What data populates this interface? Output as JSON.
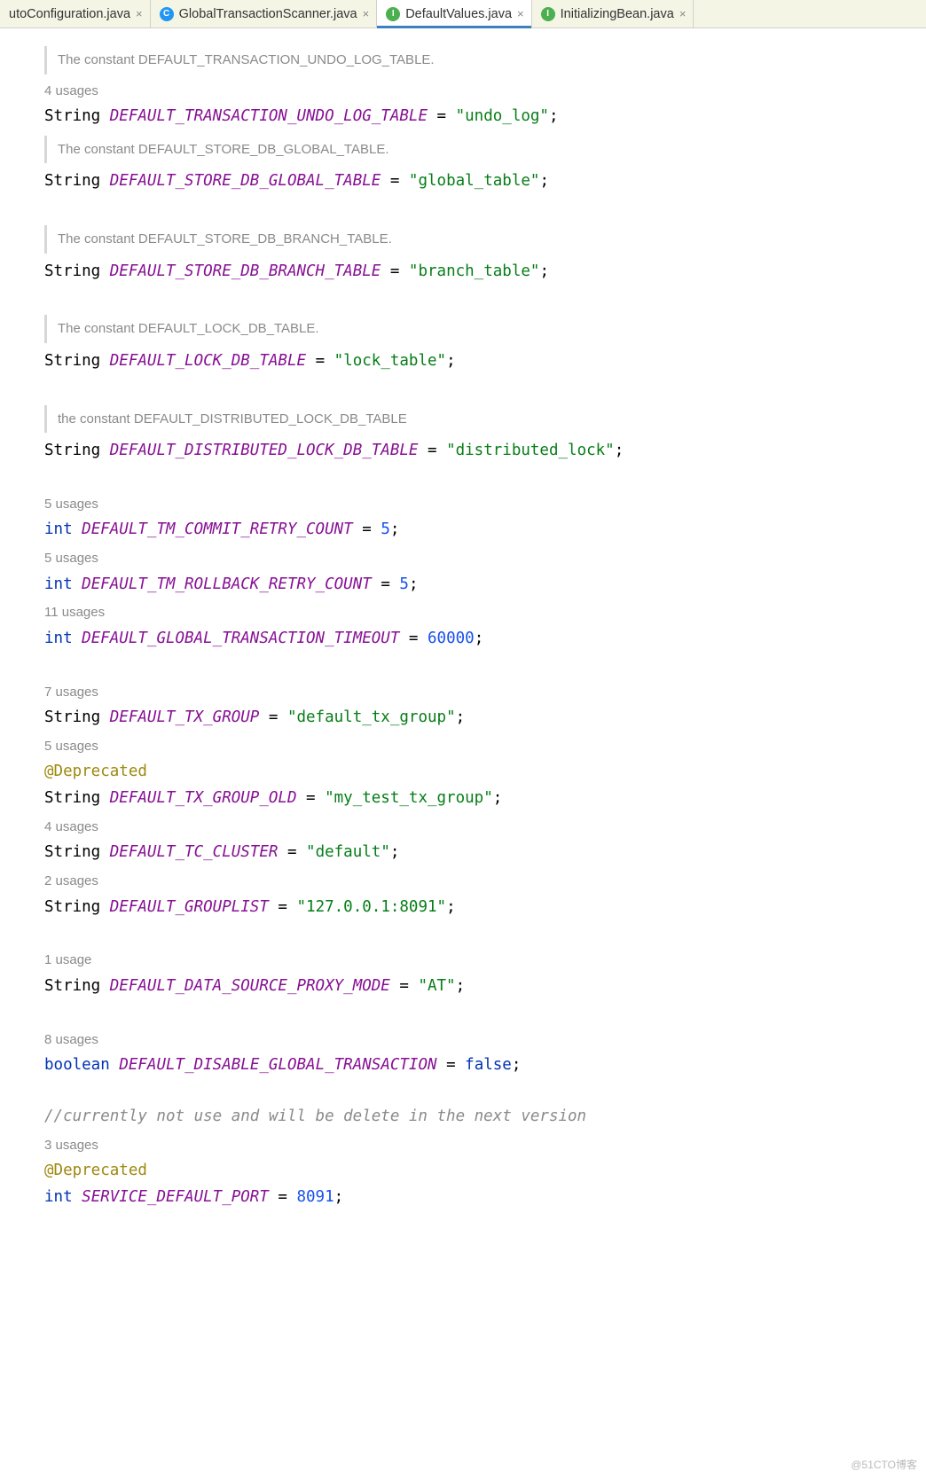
{
  "tabs": [
    {
      "label": "utoConfiguration.java",
      "icon": "",
      "active": false
    },
    {
      "label": "GlobalTransactionScanner.java",
      "icon": "C",
      "iconClass": "icon-c",
      "active": false
    },
    {
      "label": "DefaultValues.java",
      "icon": "I",
      "iconClass": "icon-i",
      "active": true
    },
    {
      "label": "InitializingBean.java",
      "icon": "I",
      "iconClass": "icon-i",
      "active": false
    }
  ],
  "close_glyph": "×",
  "watermark": "@51CTO博客",
  "blocks": [
    {
      "kind": "doc",
      "text": "The constant DEFAULT_TRANSACTION_UNDO_LOG_TABLE."
    },
    {
      "kind": "usages",
      "text": "4 usages"
    },
    {
      "kind": "decl",
      "type": "String",
      "name": "DEFAULT_TRANSACTION_UNDO_LOG_TABLE",
      "valKind": "str",
      "val": "\"undo_log\""
    },
    {
      "kind": "doc",
      "text": "The constant DEFAULT_STORE_DB_GLOBAL_TABLE."
    },
    {
      "kind": "decl",
      "type": "String",
      "name": "DEFAULT_STORE_DB_GLOBAL_TABLE",
      "valKind": "str",
      "val": "\"global_table\""
    },
    {
      "kind": "blank2"
    },
    {
      "kind": "doc",
      "text": "The constant DEFAULT_STORE_DB_BRANCH_TABLE."
    },
    {
      "kind": "decl",
      "type": "String",
      "name": "DEFAULT_STORE_DB_BRANCH_TABLE",
      "valKind": "str",
      "val": "\"branch_table\""
    },
    {
      "kind": "blank2"
    },
    {
      "kind": "doc",
      "text": "The constant DEFAULT_LOCK_DB_TABLE."
    },
    {
      "kind": "decl",
      "type": "String",
      "name": "DEFAULT_LOCK_DB_TABLE",
      "valKind": "str",
      "val": "\"lock_table\""
    },
    {
      "kind": "blank2"
    },
    {
      "kind": "doc",
      "text": "the constant DEFAULT_DISTRIBUTED_LOCK_DB_TABLE"
    },
    {
      "kind": "decl",
      "type": "String",
      "name": "DEFAULT_DISTRIBUTED_LOCK_DB_TABLE",
      "valKind": "str",
      "val": "\"distributed_lock\""
    },
    {
      "kind": "blank2"
    },
    {
      "kind": "usages",
      "text": "5 usages"
    },
    {
      "kind": "decl",
      "type": "int",
      "typeKw": true,
      "name": "DEFAULT_TM_COMMIT_RETRY_COUNT",
      "valKind": "num",
      "val": "5"
    },
    {
      "kind": "usages",
      "text": "5 usages"
    },
    {
      "kind": "decl",
      "type": "int",
      "typeKw": true,
      "name": "DEFAULT_TM_ROLLBACK_RETRY_COUNT",
      "valKind": "num",
      "val": "5"
    },
    {
      "kind": "usages",
      "text": "11 usages"
    },
    {
      "kind": "decl",
      "type": "int",
      "typeKw": true,
      "name": "DEFAULT_GLOBAL_TRANSACTION_TIMEOUT",
      "valKind": "num",
      "val": "60000"
    },
    {
      "kind": "blank2"
    },
    {
      "kind": "usages",
      "text": "7 usages"
    },
    {
      "kind": "decl",
      "type": "String",
      "name": "DEFAULT_TX_GROUP",
      "valKind": "str",
      "val": "\"default_tx_group\""
    },
    {
      "kind": "usages",
      "text": "5 usages"
    },
    {
      "kind": "anno",
      "text": "@Deprecated"
    },
    {
      "kind": "decl",
      "type": "String",
      "name": "DEFAULT_TX_GROUP_OLD",
      "valKind": "str",
      "val": "\"my_test_tx_group\""
    },
    {
      "kind": "usages",
      "text": "4 usages"
    },
    {
      "kind": "decl",
      "type": "String",
      "name": "DEFAULT_TC_CLUSTER",
      "valKind": "str",
      "val": "\"default\""
    },
    {
      "kind": "usages",
      "text": "2 usages"
    },
    {
      "kind": "decl",
      "type": "String",
      "name": "DEFAULT_GROUPLIST",
      "valKind": "str",
      "val": "\"127.0.0.1:8091\""
    },
    {
      "kind": "blank2"
    },
    {
      "kind": "usages",
      "text": "1 usage"
    },
    {
      "kind": "decl",
      "type": "String",
      "name": "DEFAULT_DATA_SOURCE_PROXY_MODE",
      "valKind": "str",
      "val": "\"AT\""
    },
    {
      "kind": "blank2"
    },
    {
      "kind": "usages",
      "text": "8 usages"
    },
    {
      "kind": "decl",
      "type": "boolean",
      "typeKw": true,
      "name": "DEFAULT_DISABLE_GLOBAL_TRANSACTION",
      "valKind": "bool",
      "val": "false"
    },
    {
      "kind": "blank2"
    },
    {
      "kind": "comment",
      "text": "//currently not use and will be delete in the next version"
    },
    {
      "kind": "usages",
      "text": "3 usages"
    },
    {
      "kind": "anno",
      "text": "@Deprecated"
    },
    {
      "kind": "decl",
      "type": "int",
      "typeKw": true,
      "name": "SERVICE_DEFAULT_PORT",
      "valKind": "num",
      "val": "8091"
    }
  ]
}
